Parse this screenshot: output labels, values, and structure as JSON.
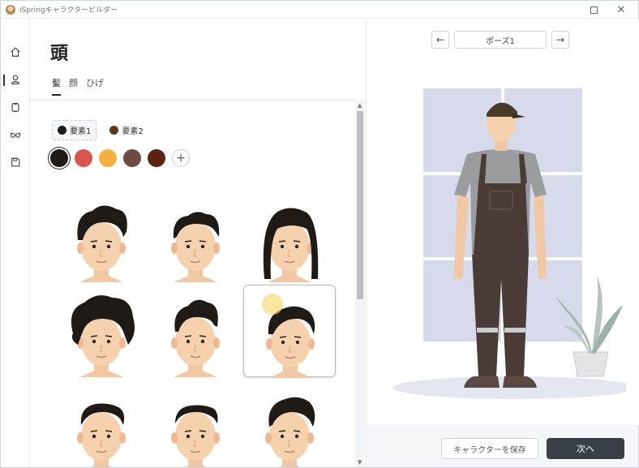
{
  "window": {
    "title": "iSpringキャラクタービルダー"
  },
  "rail": {
    "items": [
      {
        "name": "home-icon"
      },
      {
        "name": "user-icon",
        "active": true
      },
      {
        "name": "shirt-icon"
      },
      {
        "name": "glasses-icon"
      },
      {
        "name": "save-icon"
      }
    ]
  },
  "editor": {
    "title": "頭",
    "tabs": [
      {
        "label": "髪",
        "active": true
      },
      {
        "label": "顔",
        "active": false
      },
      {
        "label": "ひげ",
        "active": false
      }
    ],
    "elements": [
      {
        "label": "要素1",
        "color": "#1f1a15",
        "active": true
      },
      {
        "label": "要素2",
        "color": "#5a3a18",
        "active": false
      }
    ],
    "swatches": [
      "#1f1a15",
      "#d9534f",
      "#f5b041",
      "#6e4a44",
      "#5b2312"
    ],
    "selected_swatch": 0,
    "add_color_label": "+",
    "hairstyles": [
      {
        "id": "hair-1",
        "style": "quiff"
      },
      {
        "id": "hair-2",
        "style": "wavy-short"
      },
      {
        "id": "hair-3",
        "style": "long"
      },
      {
        "id": "hair-4",
        "style": "afro"
      },
      {
        "id": "hair-5",
        "style": "curly-top"
      },
      {
        "id": "hair-6",
        "style": "side-swept",
        "selected": true
      },
      {
        "id": "hair-7",
        "style": "crew"
      },
      {
        "id": "hair-8",
        "style": "buzz"
      },
      {
        "id": "hair-9",
        "style": "pompadour"
      }
    ]
  },
  "preview": {
    "prev_icon": "←",
    "next_icon": "→",
    "pose_label": "ポーズ1",
    "colors": {
      "cap": "#4a3a2a",
      "shirt": "#9a9c9e",
      "overalls": "#4a3a36",
      "window": "#d5d9ea"
    }
  },
  "footer": {
    "save_label": "キャラクターを保存",
    "next_label": "次へ"
  }
}
